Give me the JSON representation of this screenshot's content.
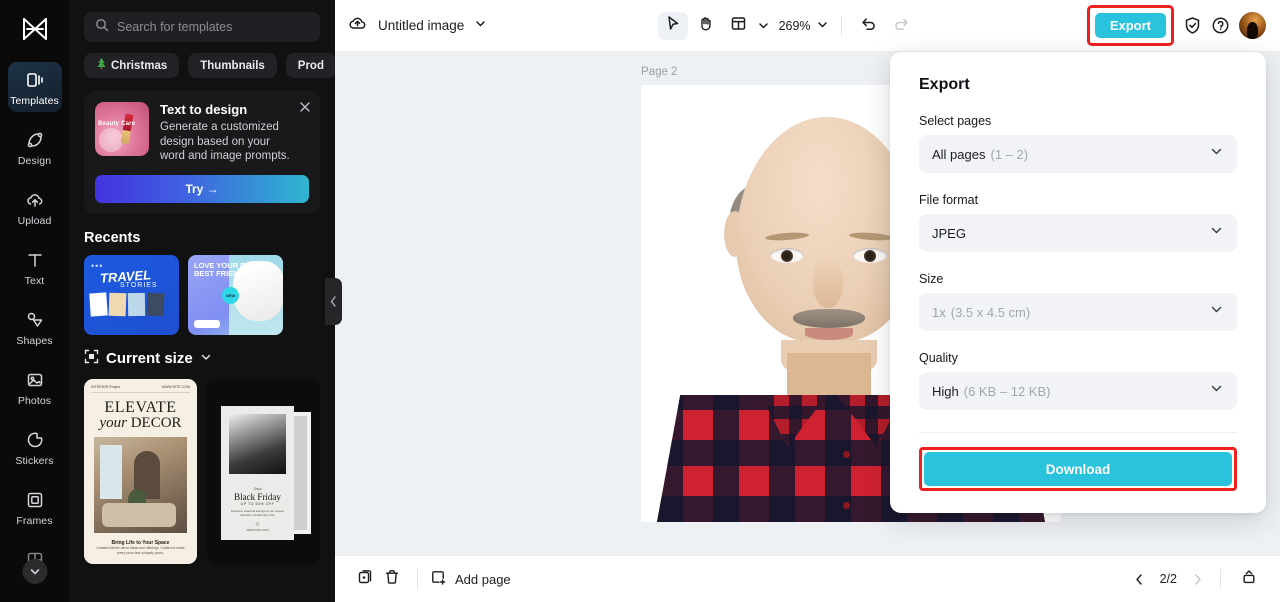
{
  "rail": {
    "logo_icon": "capcut-logo-icon",
    "items": [
      {
        "label": "Templates",
        "icon": "templates-icon",
        "active": true
      },
      {
        "label": "Design",
        "icon": "design-icon",
        "active": false
      },
      {
        "label": "Upload",
        "icon": "upload-cloud-icon",
        "active": false
      },
      {
        "label": "Text",
        "icon": "text-icon",
        "active": false
      },
      {
        "label": "Shapes",
        "icon": "shapes-icon",
        "active": false
      },
      {
        "label": "Photos",
        "icon": "photos-icon",
        "active": false
      },
      {
        "label": "Stickers",
        "icon": "stickers-icon",
        "active": false
      },
      {
        "label": "Frames",
        "icon": "frames-icon",
        "active": false
      }
    ],
    "more_icon": "chevron-down-icon"
  },
  "sidebar": {
    "search": {
      "placeholder": "Search for templates",
      "icon": "search-icon"
    },
    "chips": [
      {
        "label": "Christmas",
        "icon": "christmas-tree-icon"
      },
      {
        "label": "Thumbnails",
        "icon": ""
      },
      {
        "label": "Prod",
        "icon": ""
      }
    ],
    "promo": {
      "title": "Text to design",
      "description": "Generate a customized design based on your word and image prompts.",
      "thumb_text": "Beauty Care",
      "cta": "Try →",
      "close_icon": "close-icon"
    },
    "recents": {
      "title": "Recents",
      "cards": [
        {
          "title": "TRAVEL",
          "subtitle": "STORIES"
        },
        {
          "title": "LOVE YOUR FURRY BEST FRIEND",
          "badge": "NEW",
          "button": "Shop now"
        }
      ]
    },
    "current_size": {
      "label": "Current size",
      "icon": "resize-icon",
      "chevron": "chevron-down-icon"
    },
    "templates": [
      {
        "header_left": "INTERIOR Project",
        "header_right": "WWW.SITE.COM",
        "title_line1": "ELEVATE",
        "title_line2_italic": "your",
        "title_line2_rest": "DECOR",
        "footer_title": "Bring Life to Your Space",
        "footer_text": "Curated interior decor ideas and offerings. Crafted to make every room feel uniquely yours."
      },
      {
        "pretitle": "Shop",
        "title": "Black Friday",
        "subtitle": "UP TO 50% OFF",
        "body": "Exclusive seasonal savings on our newest collection. Limited time only.",
        "footer": "WWW.SITE.COM"
      }
    ],
    "collapse_handle_icon": "chevron-left-icon"
  },
  "topbar": {
    "cloud_icon": "cloud-saved-icon",
    "doc_title": "Untitled image",
    "doc_chevron": "chevron-down-icon",
    "tools": [
      {
        "name": "select-tool",
        "icon": "cursor-arrow-icon",
        "active": true
      },
      {
        "name": "hand-tool",
        "icon": "hand-icon",
        "active": false
      },
      {
        "name": "layout-tool",
        "icon": "layout-panel-icon",
        "active": false
      }
    ],
    "layout_chevron": "chevron-down-icon",
    "zoom_level": "269%",
    "zoom_chevron": "chevron-down-icon",
    "undo_icon": "undo-icon",
    "redo_icon": "redo-icon",
    "export_label": "Export",
    "shield_icon": "shield-check-icon",
    "help_icon": "help-circle-icon",
    "avatar": "user-avatar"
  },
  "canvas": {
    "page_label": "Page 2"
  },
  "export_panel": {
    "title": "Export",
    "fields": [
      {
        "label": "Select pages",
        "value": "All pages",
        "sub": "(1 – 2)",
        "muted": false
      },
      {
        "label": "File format",
        "value": "JPEG",
        "sub": "",
        "muted": false
      },
      {
        "label": "Size",
        "value": "1x",
        "sub": "(3.5 x 4.5 cm)",
        "muted": true
      },
      {
        "label": "Quality",
        "value": "High",
        "sub": "(6 KB – 12 KB)",
        "muted": false
      }
    ],
    "download_label": "Download",
    "chevron_icon": "chevron-down-icon",
    "highlight_color": "#ef2020",
    "accent_color": "#29c3de"
  },
  "bottombar": {
    "duplicate_icon": "duplicate-page-icon",
    "delete_icon": "trash-icon",
    "add_page_label": "Add page",
    "add_page_icon": "add-page-icon",
    "prev_icon": "chevron-left-icon",
    "next_icon": "chevron-right-icon",
    "page_indicator": "2/2",
    "grid_icon": "page-grid-icon"
  }
}
